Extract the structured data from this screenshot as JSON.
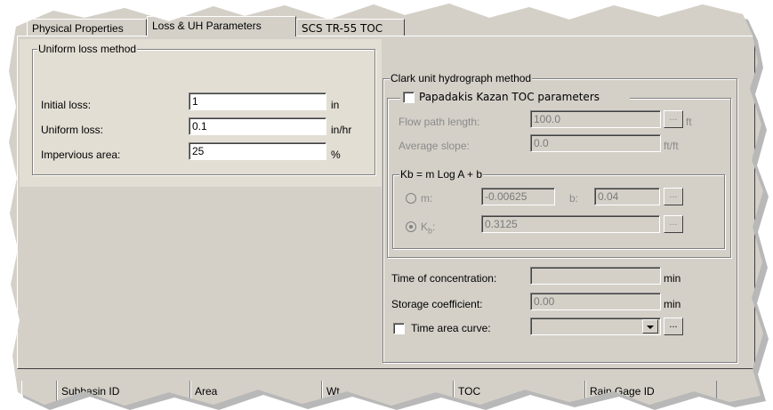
{
  "tabs": [
    {
      "label": "Physical Properties",
      "active": false
    },
    {
      "label": "Loss & UH Parameters",
      "active": true
    },
    {
      "label": "SCS TR-55 TOC",
      "active": false
    }
  ],
  "uniform_loss": {
    "title": "Uniform loss method",
    "rows": [
      {
        "label": "Initial loss:",
        "value": "1",
        "unit": "in"
      },
      {
        "label": "Uniform loss:",
        "value": "0.1",
        "unit": "in/hr"
      },
      {
        "label": "Impervious area:",
        "value": "25",
        "unit": "%"
      }
    ]
  },
  "clark": {
    "title": "Clark unit hydrograph method",
    "papadakis": {
      "checkbox_label": "Papadakis Kazan TOC parameters",
      "checked": false,
      "flow_path_label": "Flow path length:",
      "flow_path_value": "100.0",
      "flow_path_unit": "ft",
      "avg_slope_label": "Average slope:",
      "avg_slope_value": "0.0",
      "avg_slope_unit": "ft/ft",
      "kb_group_title": "Kb = m Log A + b",
      "m_label": "m:",
      "m_value": "-0.00625",
      "b_label": "b:",
      "b_value": "0.04",
      "kb_label": "K",
      "kb_sub": "b",
      "kb_colon": ":",
      "kb_value": "0.3125",
      "browse_label": "..."
    },
    "toc_label": "Time of concentration:",
    "toc_value": "",
    "toc_unit": "min",
    "storage_label": "Storage coefficient:",
    "storage_value": "0.00",
    "storage_unit": "min",
    "time_area_label": "Time area curve:",
    "time_area_checked": false,
    "time_area_value": "",
    "browse_label": "..."
  },
  "grid_headers": [
    {
      "label": "Subbasin ID"
    },
    {
      "label": "Area"
    },
    {
      "label": "Wt."
    },
    {
      "label": "TOC"
    },
    {
      "label": "Rain Gage ID"
    }
  ],
  "colors": {
    "face": "#d4d0c8",
    "highlight_panel": "#e3ded4",
    "torn_shadow": "#a0a0a0"
  }
}
